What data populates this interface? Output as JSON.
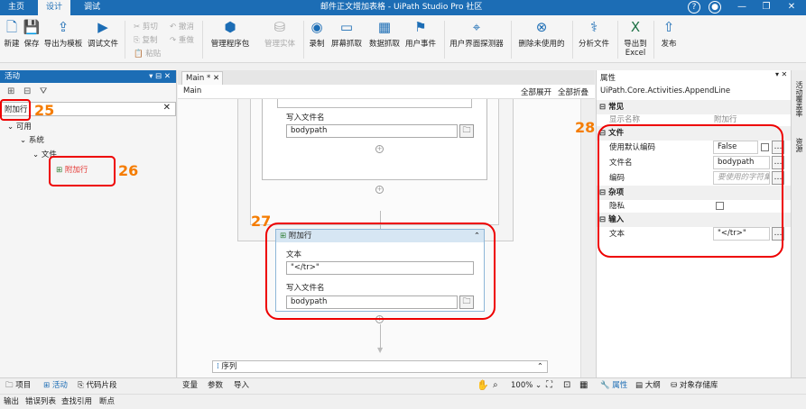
{
  "titlebar": {
    "tabs": [
      "主页",
      "设计",
      "调试"
    ],
    "title": "邮件正文增加表格 - UiPath Studio Pro 社区"
  },
  "ribbon": {
    "new": "新建",
    "save": "保存",
    "export_template": "导出为模板",
    "debug_file": "调试文件",
    "cut": "剪切",
    "copy": "复制",
    "paste": "粘贴",
    "undo": "撤消",
    "redo": "重做",
    "manage_packages": "管理程序包",
    "manage_entities": "管理实体",
    "record": "录制",
    "screen_scraping": "屏幕抓取",
    "data_scraping": "数据抓取",
    "user_events": "用户事件",
    "ui_explorer": "用户界面探测器",
    "remove_unused": "删除未使用的",
    "analyze_file": "分析文件",
    "export_excel_1": "导出到",
    "export_excel_2": "Excel",
    "publish": "发布"
  },
  "activities": {
    "panel_title": "活动",
    "search_value": "附加行",
    "tree": {
      "available": "可用",
      "system": "系统",
      "file": "文件",
      "item": "附加行"
    }
  },
  "designer": {
    "tab": "Main *",
    "breadcrumb": "Main",
    "expand_all": "全部展开",
    "collapse_all": "全部折叠",
    "upper": {
      "label": "写入文件名",
      "value": "bodypath"
    },
    "activity": {
      "title": "附加行",
      "text_label": "文本",
      "text_value": "\"</tr>\"",
      "file_label": "写入文件名",
      "file_value": "bodypath"
    },
    "sequence": "序列"
  },
  "properties": {
    "panel_title": "属性",
    "type": "UiPath.Core.Activities.AppendLine",
    "cat_common": "常见",
    "display_name_label": "显示名称",
    "display_name_value": "附加行",
    "cat_file": "文件",
    "use_default_encoding": "使用默认编码",
    "use_default_encoding_value": "False",
    "filename_label": "文件名",
    "filename_value": "bodypath",
    "encoding_label": "编码",
    "encoding_placeholder": "要使用的字符集",
    "cat_misc": "杂项",
    "private_label": "隐私",
    "cat_input": "输入",
    "text_label": "文本",
    "text_value": "\"</tr>\""
  },
  "right_strip": {
    "tab1": "活动覆盖率",
    "tab2": "资源"
  },
  "bottom_left": {
    "project": "项目",
    "activities": "活动",
    "snippets": "代码片段"
  },
  "bottom_center": {
    "variables": "变量",
    "arguments": "参数",
    "imports": "导入",
    "zoom": "100%"
  },
  "bottom_right": {
    "properties": "属性",
    "outline": "大纲",
    "object_repo": "对象存储库"
  },
  "statusbar": {
    "output": "输出",
    "error_list": "错误列表",
    "find_refs": "查找引用",
    "breakpoints": "断点"
  },
  "annotations": {
    "n25": "25",
    "n26": "26",
    "n27": "27",
    "n28": "28"
  }
}
